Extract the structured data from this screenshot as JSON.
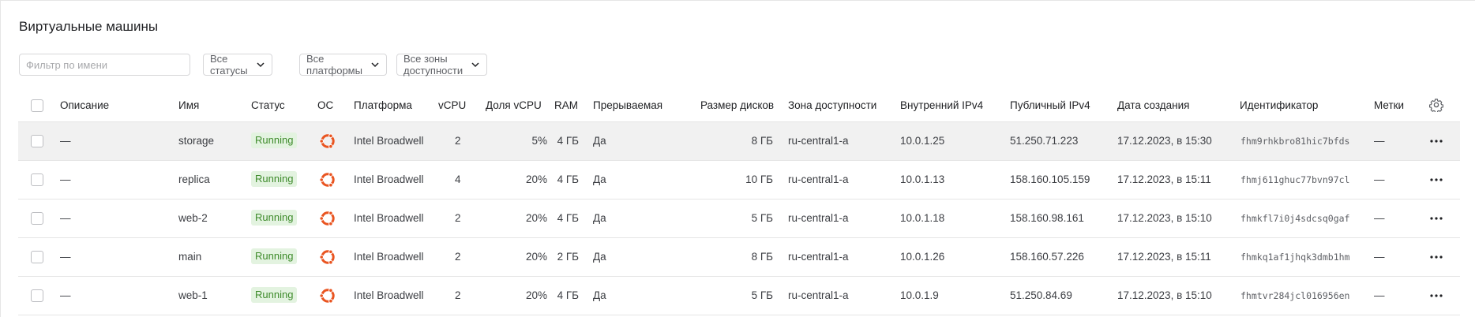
{
  "page": {
    "title": "Виртуальные машины"
  },
  "filters": {
    "name_placeholder": "Фильтр по имени",
    "status": "Все статусы",
    "platform": "Все платформы",
    "zone": "Все зоны доступности"
  },
  "columns": {
    "description": "Описание",
    "name": "Имя",
    "status": "Статус",
    "os": "ОС",
    "platform": "Платформа",
    "vcpu": "vCPU",
    "vcpu_share": "Доля vCPU",
    "ram": "RAM",
    "preemptible": "Прерываемая",
    "disk_size": "Размер дисков",
    "zone": "Зона доступности",
    "internal_ip": "Внутренний IPv4",
    "public_ip": "Публичный IPv4",
    "created": "Дата создания",
    "id": "Идентификатор",
    "labels": "Метки"
  },
  "rows": [
    {
      "description": "—",
      "name": "storage",
      "status": "Running",
      "os_icon": "ubuntu-icon",
      "platform": "Intel Broadwell",
      "vcpu": "2",
      "vcpu_share": "5%",
      "ram": "4 ГБ",
      "preemptible": "Да",
      "disk_size": "8 ГБ",
      "zone": "ru-central1-a",
      "internal_ip": "10.0.1.25",
      "public_ip": "51.250.71.223",
      "created": "17.12.2023, в 15:30",
      "id": "fhm9rhkbro81hic7bfds",
      "labels": "—"
    },
    {
      "description": "—",
      "name": "replica",
      "status": "Running",
      "os_icon": "ubuntu-icon",
      "platform": "Intel Broadwell",
      "vcpu": "4",
      "vcpu_share": "20%",
      "ram": "4 ГБ",
      "preemptible": "Да",
      "disk_size": "10 ГБ",
      "zone": "ru-central1-a",
      "internal_ip": "10.0.1.13",
      "public_ip": "158.160.105.159",
      "created": "17.12.2023, в 15:11",
      "id": "fhmj611ghuc77bvn97cl",
      "labels": "—"
    },
    {
      "description": "—",
      "name": "web-2",
      "status": "Running",
      "os_icon": "ubuntu-icon",
      "platform": "Intel Broadwell",
      "vcpu": "2",
      "vcpu_share": "20%",
      "ram": "4 ГБ",
      "preemptible": "Да",
      "disk_size": "5 ГБ",
      "zone": "ru-central1-a",
      "internal_ip": "10.0.1.18",
      "public_ip": "158.160.98.161",
      "created": "17.12.2023, в 15:10",
      "id": "fhmkfl7i0j4sdcsq0gaf",
      "labels": "—"
    },
    {
      "description": "—",
      "name": "main",
      "status": "Running",
      "os_icon": "ubuntu-icon",
      "platform": "Intel Broadwell",
      "vcpu": "2",
      "vcpu_share": "20%",
      "ram": "2 ГБ",
      "preemptible": "Да",
      "disk_size": "8 ГБ",
      "zone": "ru-central1-a",
      "internal_ip": "10.0.1.26",
      "public_ip": "158.160.57.226",
      "created": "17.12.2023, в 15:11",
      "id": "fhmkq1af1jhqk3dmb1hm",
      "labels": "—"
    },
    {
      "description": "—",
      "name": "web-1",
      "status": "Running",
      "os_icon": "ubuntu-icon",
      "platform": "Intel Broadwell",
      "vcpu": "2",
      "vcpu_share": "20%",
      "ram": "4 ГБ",
      "preemptible": "Да",
      "disk_size": "5 ГБ",
      "zone": "ru-central1-a",
      "internal_ip": "10.0.1.9",
      "public_ip": "51.250.84.69",
      "created": "17.12.2023, в 15:10",
      "id": "fhmtvr284jcl016956en",
      "labels": "—"
    }
  ],
  "colors": {
    "status_running_bg": "#e3f3e0",
    "status_running_fg": "#3e8b2b",
    "ubuntu": "#e95420",
    "row_highlight": "#f1f1f1"
  }
}
